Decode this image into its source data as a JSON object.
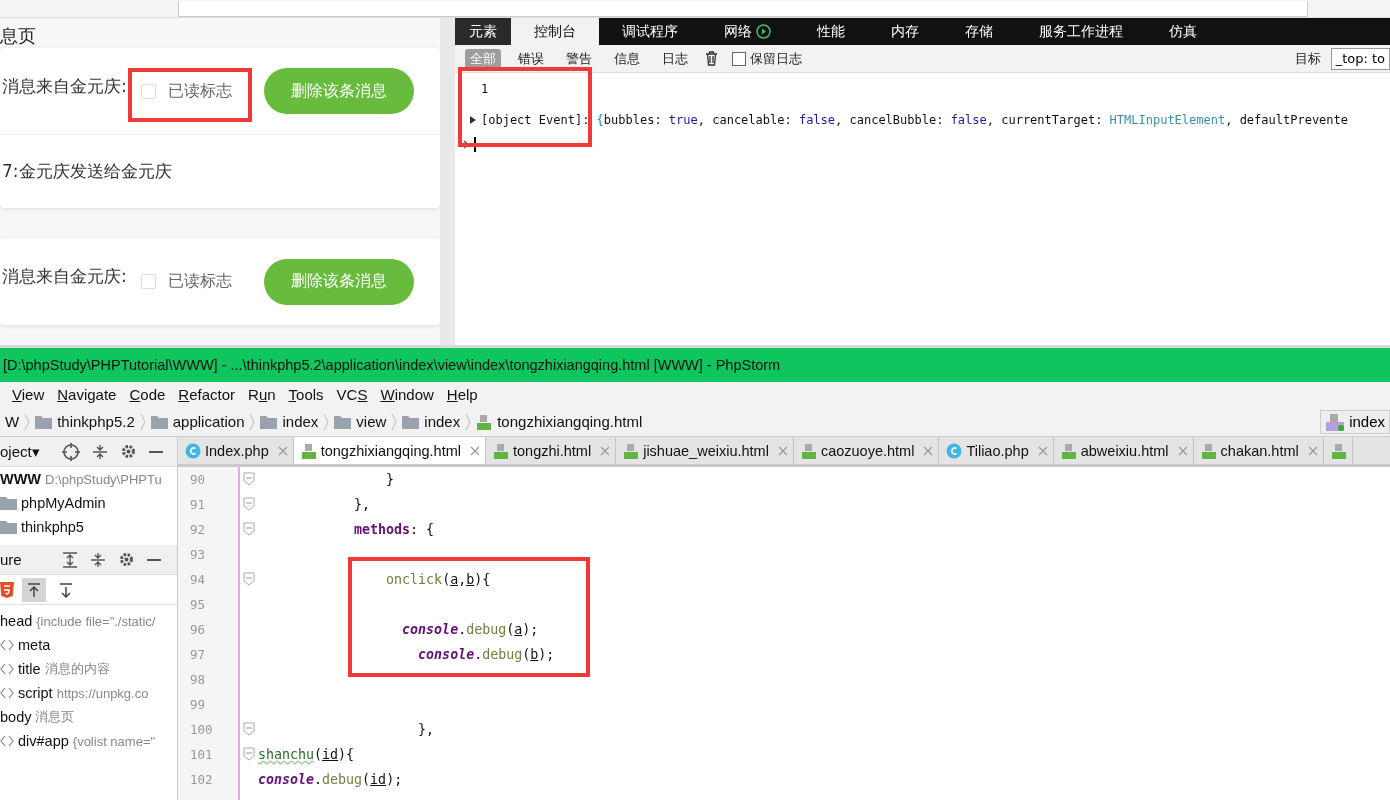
{
  "browser": {
    "page_title": "息页",
    "cards": [
      {
        "rows": [
          {
            "kind": "message",
            "sender": "消息来自金元庆:",
            "read_label": "已读标志",
            "checked": false,
            "delete_button": "删除该条消息",
            "highlighted": true
          },
          {
            "kind": "text",
            "text": "7:金元庆发送给金元庆"
          }
        ]
      },
      {
        "rows": [
          {
            "kind": "message",
            "sender": "消息来自金元庆:",
            "read_label": "已读标志",
            "checked": false,
            "delete_button": "删除该条消息",
            "highlighted": false
          }
        ]
      }
    ]
  },
  "devtools": {
    "tabs": [
      {
        "label": "元素",
        "selected": false,
        "kind": "plain"
      },
      {
        "label": "控制台",
        "selected": true,
        "kind": "plain"
      },
      {
        "label": "调试程序",
        "selected": false,
        "kind": "plain"
      },
      {
        "label": "网络",
        "selected": false,
        "kind": "recording"
      },
      {
        "label": "性能",
        "selected": false,
        "kind": "plain"
      },
      {
        "label": "内存",
        "selected": false,
        "kind": "plain"
      },
      {
        "label": "存储",
        "selected": false,
        "kind": "plain"
      },
      {
        "label": "服务工作进程",
        "selected": false,
        "kind": "plain"
      },
      {
        "label": "仿真",
        "selected": false,
        "kind": "plain"
      }
    ],
    "filters": [
      {
        "label": "全部",
        "selected": true
      },
      {
        "label": "错误",
        "selected": false
      },
      {
        "label": "警告",
        "selected": false
      },
      {
        "label": "信息",
        "selected": false
      },
      {
        "label": "日志",
        "selected": false
      }
    ],
    "preserve_log": {
      "label": "保留日志",
      "checked": false
    },
    "target_label": "目标",
    "target_value": "_top: to",
    "console_highlighted": true,
    "console": [
      {
        "expandable": false,
        "tokens": [
          {
            "text": "1",
            "kind": "plain"
          }
        ]
      },
      {
        "expandable": true,
        "tokens": [
          {
            "text": "[object Event]: ",
            "kind": "plain"
          },
          {
            "text": "{",
            "kind": "brace"
          },
          {
            "text": "bubbles: ",
            "kind": "plain"
          },
          {
            "text": "true",
            "kind": "keyword"
          },
          {
            "text": ", cancelable: ",
            "kind": "plain"
          },
          {
            "text": "false",
            "kind": "keyword"
          },
          {
            "text": ", cancelBubble: ",
            "kind": "plain"
          },
          {
            "text": "false",
            "kind": "keyword"
          },
          {
            "text": ", currentTarget: ",
            "kind": "plain"
          },
          {
            "text": "HTMLInputElement",
            "kind": "type"
          },
          {
            "text": ", defaultPrevente",
            "kind": "plain"
          }
        ]
      }
    ]
  },
  "ide": {
    "title": "[D:\\phpStudy\\PHPTutorial\\WWW] - ...\\thinkphp5.2\\application\\index\\view\\index\\tongzhixiangqing.html [WWW] - PhpStorm",
    "menu": [
      [
        {
          "text": "V",
          "underlined": true
        },
        {
          "text": "iew",
          "underlined": false
        }
      ],
      [
        {
          "text": "N",
          "underlined": true
        },
        {
          "text": "avigate",
          "underlined": false
        }
      ],
      [
        {
          "text": "C",
          "underlined": true
        },
        {
          "text": "ode",
          "underlined": false
        }
      ],
      [
        {
          "text": "R",
          "underlined": true
        },
        {
          "text": "efactor",
          "underlined": false
        }
      ],
      [
        {
          "text": "R",
          "underlined": false
        },
        {
          "text": "u",
          "underlined": true
        },
        {
          "text": "n",
          "underlined": false
        }
      ],
      [
        {
          "text": "T",
          "underlined": true
        },
        {
          "text": "ools",
          "underlined": false
        }
      ],
      [
        {
          "text": "VC",
          "underlined": false
        },
        {
          "text": "S",
          "underlined": true
        }
      ],
      [
        {
          "text": "W",
          "underlined": true
        },
        {
          "text": "indow",
          "underlined": false
        }
      ],
      [
        {
          "text": "H",
          "underlined": true
        },
        {
          "text": "elp",
          "underlined": false
        }
      ]
    ],
    "breadcrumb": [
      {
        "label": "W",
        "kind": "plain"
      },
      {
        "label": "thinkphp5.2",
        "kind": "folder"
      },
      {
        "label": "application",
        "kind": "folder"
      },
      {
        "label": "index",
        "kind": "folder"
      },
      {
        "label": "view",
        "kind": "folder"
      },
      {
        "label": "index",
        "kind": "folder"
      },
      {
        "label": "tongzhixiangqing.html",
        "kind": "html"
      }
    ],
    "nav_file": "index",
    "project_label": "oject▾",
    "project_tree": [
      {
        "label": "WWW",
        "path": "D:\\phpStudy\\PHPTu",
        "kind": "root"
      },
      {
        "label": "phpMyAdmin",
        "kind": "folder"
      },
      {
        "label": "thinkphp5",
        "kind": "folder"
      }
    ],
    "structure_label": "ure",
    "structure_tree": [
      {
        "label": "head",
        "detail": "{include file=\"./static/",
        "kind": "plain"
      },
      {
        "label": "meta",
        "kind": "tag"
      },
      {
        "label": "title",
        "detail": "消息的内容",
        "kind": "tag"
      },
      {
        "label": "script",
        "detail": "https://unpkg.co",
        "kind": "tag"
      },
      {
        "label": "body",
        "detail": "消息页",
        "kind": "plain"
      },
      {
        "label": "div#app",
        "detail": "{volist name=\"",
        "kind": "tag"
      }
    ],
    "tabs": [
      {
        "label": "Index.php",
        "kind": "php",
        "selected": false
      },
      {
        "label": "tongzhixiangqing.html",
        "kind": "html",
        "selected": true
      },
      {
        "label": "tongzhi.html",
        "kind": "html",
        "selected": false
      },
      {
        "label": "jishuae_weixiu.html",
        "kind": "html",
        "selected": false
      },
      {
        "label": "caozuoye.html",
        "kind": "html",
        "selected": false
      },
      {
        "label": "Tiliao.php",
        "kind": "php",
        "selected": false
      },
      {
        "label": "abweixiu.html",
        "kind": "html",
        "selected": false
      },
      {
        "label": "chakan.html",
        "kind": "html",
        "selected": false
      }
    ],
    "code": [
      {
        "number": "90",
        "fold": true,
        "highlighted": false,
        "tokens": [
          {
            "text": "                }",
            "kind": "plain"
          }
        ]
      },
      {
        "number": "91",
        "fold": true,
        "highlighted": false,
        "tokens": [
          {
            "text": "            },",
            "kind": "plain"
          }
        ]
      },
      {
        "number": "92",
        "fold": true,
        "highlighted": false,
        "tokens": [
          {
            "text": "            methods",
            "kind": "keyword"
          },
          {
            "text": ": {",
            "kind": "plain"
          }
        ]
      },
      {
        "number": "93",
        "fold": false,
        "highlighted": false
      },
      {
        "number": "94",
        "fold": true,
        "highlighted": true,
        "tokens": [
          {
            "text": "                onclick",
            "kind": "function"
          },
          {
            "text": "(",
            "kind": "plain"
          },
          {
            "text": "a",
            "kind": "param"
          },
          {
            "text": ",",
            "kind": "plain"
          },
          {
            "text": "b",
            "kind": "param"
          },
          {
            "text": "){",
            "kind": "plain"
          }
        ]
      },
      {
        "number": "95",
        "fold": false,
        "highlighted": true
      },
      {
        "number": "96",
        "fold": false,
        "highlighted": true,
        "tokens": [
          {
            "text": "                  console",
            "kind": "object"
          },
          {
            "text": ".",
            "kind": "plain"
          },
          {
            "text": "debug",
            "kind": "function"
          },
          {
            "text": "(",
            "kind": "plain"
          },
          {
            "text": "a",
            "kind": "param"
          },
          {
            "text": ");",
            "kind": "plain"
          }
        ]
      },
      {
        "number": "97",
        "fold": false,
        "highlighted": true,
        "tokens": [
          {
            "text": "                    console",
            "kind": "object"
          },
          {
            "text": ".",
            "kind": "plain"
          },
          {
            "text": "debug",
            "kind": "function"
          },
          {
            "text": "(",
            "kind": "plain"
          },
          {
            "text": "b",
            "kind": "param"
          },
          {
            "text": ");",
            "kind": "plain"
          }
        ]
      },
      {
        "number": "98",
        "fold": false,
        "highlighted": false
      },
      {
        "number": "99",
        "fold": false,
        "highlighted": false
      },
      {
        "number": "100",
        "fold": true,
        "highlighted": false,
        "tokens": [
          {
            "text": "                    },",
            "kind": "plain"
          }
        ]
      },
      {
        "number": "101",
        "fold": true,
        "highlighted": false,
        "tokens": [
          {
            "text": "shanchu",
            "kind": "warn"
          },
          {
            "text": "(",
            "kind": "plain"
          },
          {
            "text": "id",
            "kind": "param"
          },
          {
            "text": "){",
            "kind": "plain"
          }
        ]
      },
      {
        "number": "102",
        "fold": false,
        "highlighted": false,
        "tokens": [
          {
            "text": "console",
            "kind": "object"
          },
          {
            "text": ".",
            "kind": "plain"
          },
          {
            "text": "debug",
            "kind": "function"
          },
          {
            "text": "(",
            "kind": "plain"
          },
          {
            "text": "id",
            "kind": "param"
          },
          {
            "text": ");",
            "kind": "plain"
          }
        ]
      }
    ]
  }
}
